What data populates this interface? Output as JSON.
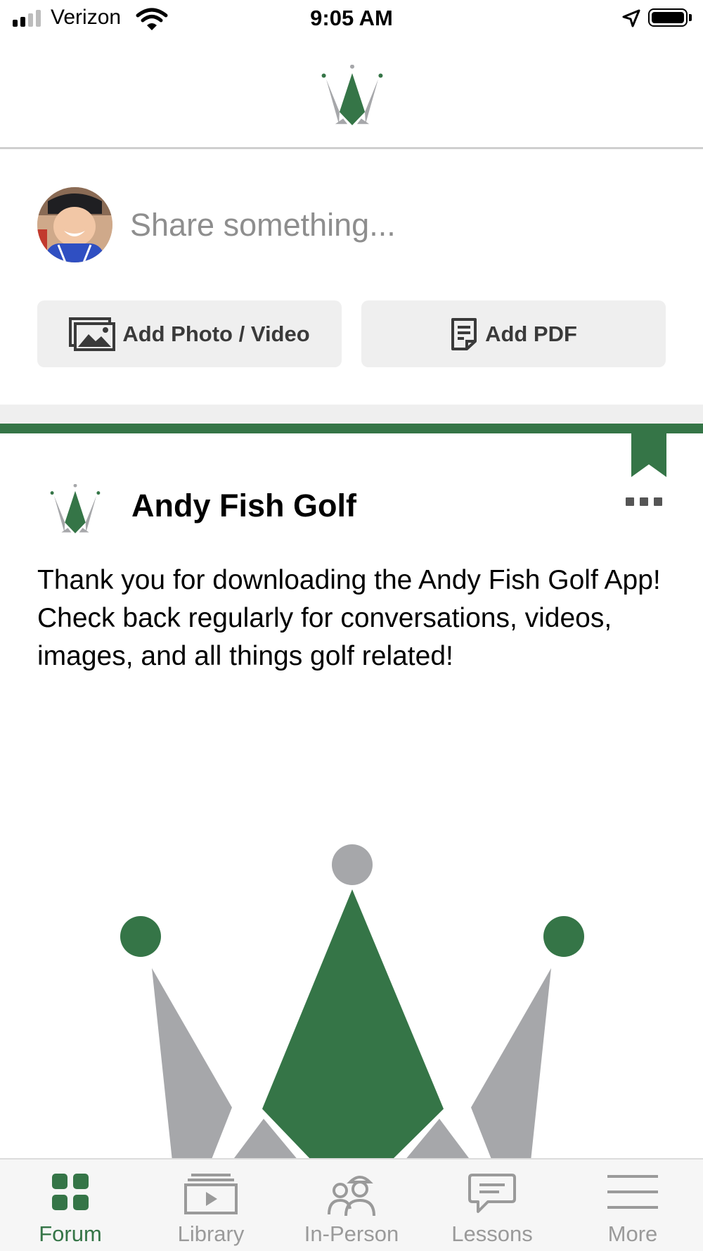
{
  "status_bar": {
    "carrier": "Verizon",
    "time": "9:05 AM",
    "battery_level": 1.0
  },
  "composer": {
    "placeholder": "Share something...",
    "add_photo_label": "Add Photo / Video",
    "add_pdf_label": "Add PDF"
  },
  "post": {
    "author": "Andy Fish Golf",
    "text": "Thank you for downloading the Andy Fish Golf App! Check back regularly for conversations, videos, images, and all things golf related!"
  },
  "tabs": [
    {
      "label": "Forum",
      "icon": "grid-icon",
      "active": true
    },
    {
      "label": "Library",
      "icon": "video-library-icon",
      "active": false
    },
    {
      "label": "In-Person",
      "icon": "people-icon",
      "active": false
    },
    {
      "label": "Lessons",
      "icon": "chat-bubble-icon",
      "active": false
    },
    {
      "label": "More",
      "icon": "menu-icon",
      "active": false
    }
  ],
  "colors": {
    "brand_green": "#357547",
    "logo_gray": "#a6a7aa",
    "inactive_tab": "#9a9a9a",
    "button_bg": "#efefef"
  }
}
